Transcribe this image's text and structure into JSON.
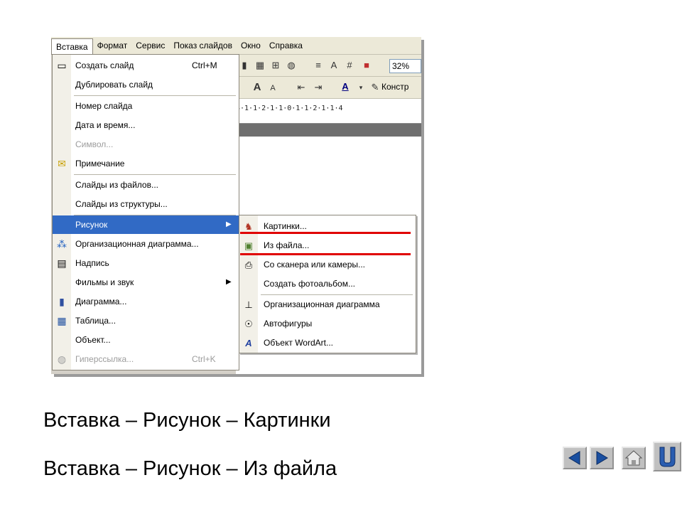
{
  "menubar": {
    "items": [
      "Вставка",
      "Формат",
      "Сервис",
      "Показ слайдов",
      "Окно",
      "Справка"
    ],
    "active": "Вставка"
  },
  "toolbar": {
    "zoom": "32%",
    "konstr_label": "Констр"
  },
  "ruler": "4·1·1·2·1·1·0·1·1·2·1·1·4",
  "insert_menu": {
    "items": [
      {
        "label": "Создать слайд",
        "shortcut": "Ctrl+M",
        "icon": "new-slide-icon"
      },
      {
        "label": "Дублировать слайд"
      },
      {
        "label": "Номер слайда"
      },
      {
        "label": "Дата и время..."
      },
      {
        "label": "Символ...",
        "disabled": true
      },
      {
        "label": "Примечание",
        "icon": "comment-icon"
      },
      {
        "label": "Слайды из файлов..."
      },
      {
        "label": "Слайды из структуры..."
      },
      {
        "label": "Рисунок",
        "submenu": true,
        "selected": true
      },
      {
        "label": "Организационная диаграмма...",
        "icon": "org-chart-icon"
      },
      {
        "label": "Надпись",
        "icon": "text-box-icon"
      },
      {
        "label": "Фильмы и звук",
        "submenu": true
      },
      {
        "label": "Диаграмма...",
        "icon": "chart-icon"
      },
      {
        "label": "Таблица...",
        "icon": "table-icon"
      },
      {
        "label": "Объект..."
      },
      {
        "label": "Гиперссылка...",
        "shortcut": "Ctrl+K",
        "disabled": true,
        "icon": "hyperlink-icon"
      }
    ]
  },
  "picture_submenu": {
    "items": [
      {
        "label": "Картинки...",
        "icon": "clip-art-icon"
      },
      {
        "label": "Из файла...",
        "icon": "picture-from-file-icon"
      },
      {
        "label": "Со сканера или камеры...",
        "icon": "scanner-icon"
      },
      {
        "label": "Создать фотоальбом..."
      },
      {
        "label": "Организационная диаграмма",
        "icon": "org-chart-icon"
      },
      {
        "label": "Автофигуры",
        "icon": "autoshapes-icon"
      },
      {
        "label": "Объект WordArt...",
        "icon": "wordart-icon"
      }
    ]
  },
  "captions": {
    "line1": "Вставка – Рисунок – Картинки",
    "line2": "Вставка – Рисунок – Из файла"
  },
  "colors": {
    "highlight": "#316ac5",
    "underline": "#e00000"
  }
}
